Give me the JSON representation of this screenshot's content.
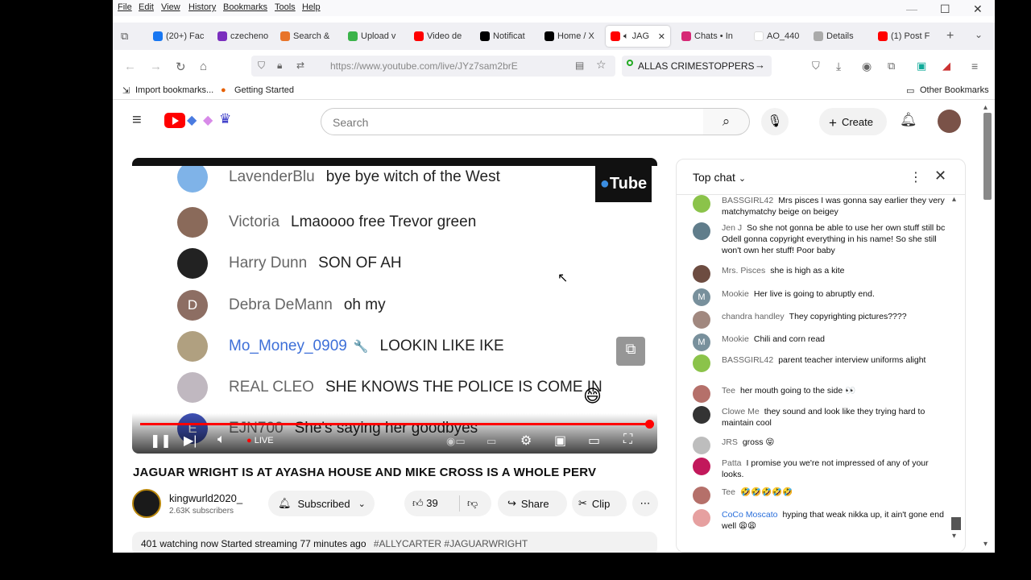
{
  "menubar": {
    "items": [
      "File",
      "Edit",
      "View",
      "History",
      "Bookmarks",
      "Tools",
      "Help"
    ],
    "minimize": "—",
    "maximize": "☐",
    "close": "✕"
  },
  "tabs": [
    {
      "label": "(20+) Fac",
      "color": "#1877f2"
    },
    {
      "label": "czecheno",
      "color": "#7b2fbe"
    },
    {
      "label": "Search &",
      "color": "#e8742a"
    },
    {
      "label": "Upload v",
      "color": "#3bb34a"
    },
    {
      "label": "Video de",
      "color": "#ff0000"
    },
    {
      "label": "Notificat",
      "color": "#000000"
    },
    {
      "label": "Home / X",
      "color": "#000000"
    },
    {
      "label": "JAG",
      "color": "#ff0000",
      "active": true
    },
    {
      "label": "Chats • In",
      "color": "#d62976"
    },
    {
      "label": "AO_440",
      "color": "#ffffff"
    },
    {
      "label": "Details",
      "color": "#aaaaaa"
    },
    {
      "label": "(1) Post F",
      "color": "#ff0000"
    }
  ],
  "nav": {
    "url": "https://www.youtube.com/live/JYz7sam2brE",
    "crime_text": "ALLAS CRIMESTOPPERS",
    "back": "←",
    "forward": "→",
    "reload": "↻",
    "home": "⌂"
  },
  "bookmarks": {
    "import": "Import bookmarks...",
    "getting_started": "Getting Started",
    "other": "Other Bookmarks"
  },
  "yt": {
    "search_placeholder": "Search",
    "create": "Create",
    "video_chat": [
      {
        "name": "LavenderBlu",
        "msg": "bye bye witch of the West",
        "color": "#7fb3e8",
        "initial": ""
      },
      {
        "name": "Victoria",
        "msg": "Lmaoooo free Trevor green",
        "color": "#8a6a5a",
        "initial": ""
      },
      {
        "name": "Harry Dunn",
        "msg": "SON OF AH",
        "color": "#222222",
        "initial": ""
      },
      {
        "name": "Debra DeMann",
        "msg": "oh my",
        "color": "#8d6e63",
        "initial": "D"
      },
      {
        "name": "Mo_Money_0909",
        "msg": "LOOKIN LIKE IKE",
        "color": "#b0a080",
        "initial": "",
        "member": true
      },
      {
        "name": "REAL CLEO",
        "msg": "SHE KNOWS THE POLICE IS COME IN",
        "color": "#c0b8c0",
        "initial": ""
      },
      {
        "name": "EJN700",
        "msg": "She's saying her goodbyes",
        "color": "#3f51b5",
        "initial": "E"
      }
    ],
    "watermark": "Tube",
    "live_label": "LIVE",
    "title": "JAGUAR WRIGHT IS AT AYASHA HOUSE AND MIKE CROSS IS A WHOLE PERV",
    "channel": {
      "name": "kingwurld2020_",
      "subs": "2.63K subscribers"
    },
    "subscribed": "Subscribed",
    "likes": "39",
    "share": "Share",
    "clip": "Clip",
    "more": "⋯",
    "desc": "401 watching now  Started streaming 77 minutes ago",
    "tags": "#ALLYCARTER #JAGUARWRIGHT"
  },
  "chat": {
    "mode": "Top chat",
    "messages": [
      {
        "name": "BASSGIRL42",
        "text": "Mrs pisces I was gonna say earlier they very matchymatchy beige on beigey",
        "color": "#8bc34a",
        "initial": ""
      },
      {
        "name": "Jen J",
        "text": "So she not gonna be able to use her own stuff still bc Odell gonna copyright everything in his name! So she still won't own her stuff! Poor baby",
        "color": "#607d8b",
        "initial": ""
      },
      {
        "name": "Mrs. Pisces",
        "text": "she is high as a kite",
        "color": "#6d4c41",
        "initial": ""
      },
      {
        "name": "Mookie",
        "text": "Her live is going to abruptly end.",
        "color": "#78909c",
        "initial": "M"
      },
      {
        "name": "chandra handley",
        "text": "They copyrighting pictures????",
        "color": "#a1887f",
        "initial": ""
      },
      {
        "name": "Mookie",
        "text": "Chili and corn read",
        "color": "#78909c",
        "initial": "M"
      },
      {
        "name": "BASSGIRL42",
        "text": "parent teacher interview uniforms alight",
        "color": "#8bc34a",
        "initial": ""
      },
      {
        "name": "Tee",
        "text": "her mouth going to the side 👀",
        "color": "#b5706a",
        "initial": ""
      },
      {
        "name": "Clowe Me",
        "text": "they sound and look like they trying hard to maintain cool",
        "color": "#333333",
        "initial": ""
      },
      {
        "name": "JRS",
        "text": "gross 😝",
        "color": "#bdbdbd",
        "initial": ""
      },
      {
        "name": "Patta",
        "text": "I promise you we're not impressed of any of your looks.",
        "color": "#c2185b",
        "initial": ""
      },
      {
        "name": "Tee",
        "text": "🤣🤣🤣🤣🤣",
        "color": "#b5706a",
        "initial": ""
      },
      {
        "name": "CoCo Moscato",
        "text": "hyping that weak nikka up, it ain't gone end well 😩😩",
        "color": "#e6a0a0",
        "initial": "",
        "member": true
      }
    ]
  }
}
